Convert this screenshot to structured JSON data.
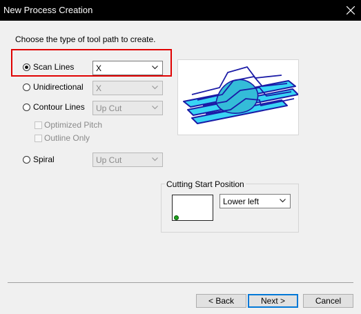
{
  "window": {
    "title": "New Process Creation"
  },
  "prompt": "Choose the type of tool path to create.",
  "options": {
    "scan_lines": {
      "label": "Scan Lines",
      "selected": true,
      "direction": "X"
    },
    "unidirectional": {
      "label": "Unidirectional",
      "direction": "X"
    },
    "contour_lines": {
      "label": "Contour Lines",
      "cut": "Up Cut"
    },
    "optimized_pitch": {
      "label": "Optimized Pitch"
    },
    "outline_only": {
      "label": "Outline Only"
    },
    "spiral": {
      "label": "Spiral",
      "cut": "Up Cut"
    }
  },
  "cutting_start": {
    "label": "Cutting Start Position",
    "value": "Lower left"
  },
  "buttons": {
    "back": "< Back",
    "next": "Next >",
    "cancel": "Cancel"
  },
  "colors": {
    "highlight": "#e00000",
    "toolpath": "#1a1aa6",
    "surface": "#39d4f5",
    "start_dot": "#1ea11e"
  }
}
